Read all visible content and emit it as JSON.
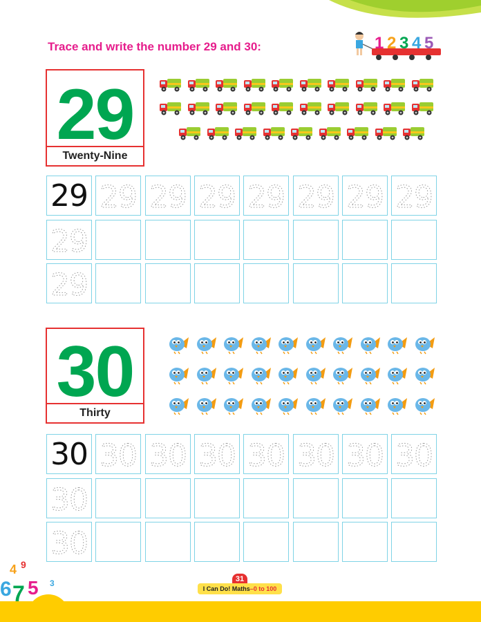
{
  "instruction": "Trace and write the number 29 and 30:",
  "decoration_digits": [
    "1",
    "2",
    "3",
    "4",
    "5"
  ],
  "sections": [
    {
      "number": "29",
      "word": "Twenty-Nine",
      "picture": "truck-icon",
      "picture_count": 29,
      "trace_cells": [
        [
          "29",
          "29",
          "29",
          "29",
          "29",
          "29",
          "29",
          "29"
        ],
        [
          "29",
          "",
          "",
          "",
          "",
          "",
          "",
          ""
        ],
        [
          "29",
          "",
          "",
          "",
          "",
          "",
          "",
          ""
        ]
      ]
    },
    {
      "number": "30",
      "word": "Thirty",
      "picture": "bird-icon",
      "picture_count": 30,
      "trace_cells": [
        [
          "30",
          "30",
          "30",
          "30",
          "30",
          "30",
          "30",
          "30"
        ],
        [
          "30",
          "",
          "",
          "",
          "",
          "",
          "",
          ""
        ],
        [
          "30",
          "",
          "",
          "",
          "",
          "",
          "",
          ""
        ]
      ]
    }
  ],
  "footer": {
    "page_number": "31",
    "book_title": "I Can Do! Maths",
    "book_subtitle": "–0 to 100"
  },
  "colors": {
    "instruction": "#e61d8c",
    "big_number": "#00a651",
    "card_border": "#e63131",
    "grid_border": "#7fd3e6",
    "footer_band": "#ffcc00"
  }
}
